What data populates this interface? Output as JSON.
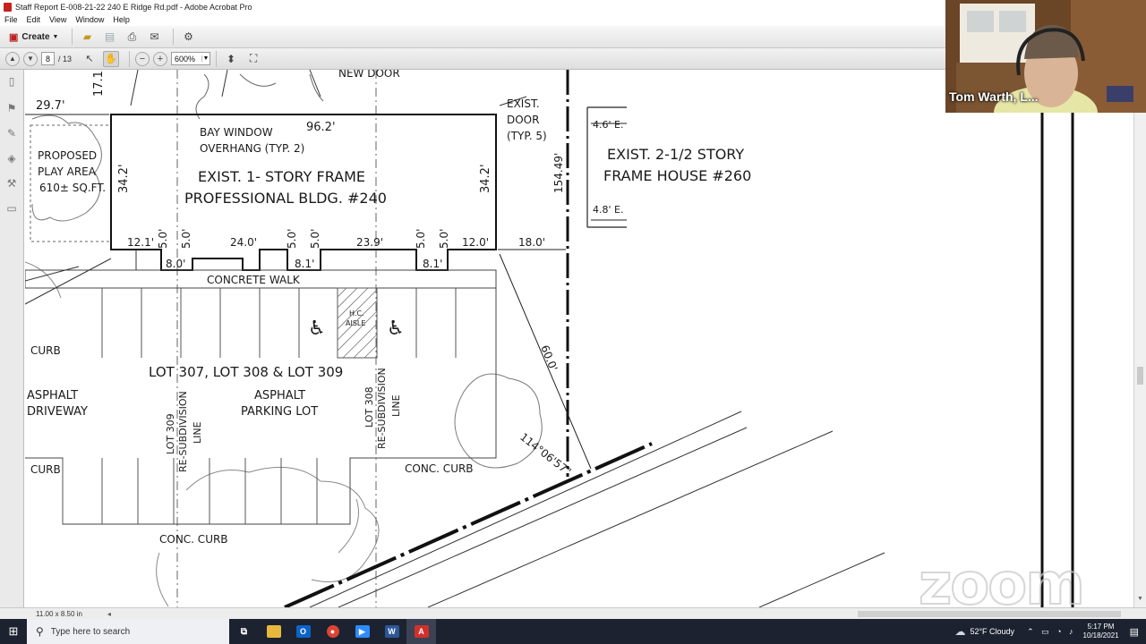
{
  "window": {
    "title": "Staff Report E-008-21-22 240 E Ridge Rd.pdf - Adobe Acrobat Pro"
  },
  "menu": [
    "File",
    "Edit",
    "View",
    "Window",
    "Help"
  ],
  "toolbar": {
    "create_label": "Create",
    "page_current": "8",
    "page_total": "/ 13",
    "zoom_value": "600%"
  },
  "document": {
    "page_size": "11.00 x 8.50 in",
    "labels": {
      "dim_29_7": "29.7'",
      "dim_17_1": "17.1'",
      "new_door": "NEW DOOR",
      "exist_door_1": "EXIST.",
      "exist_door_2": "DOOR",
      "exist_door_3": "(TYP. 5)",
      "bay_window_1": "BAY WINDOW",
      "bay_window_2": "OVERHANG (TYP. 2)",
      "dim_96_2": "96.2'",
      "proposed_1": "PROPOSED",
      "proposed_2": "PLAY AREA",
      "proposed_3": "610± SQ.FT.",
      "dim_34_2_left": "34.2'",
      "dim_34_2_right": "34.2'",
      "bldg_1": "EXIST. 1- STORY FRAME",
      "bldg_2": "PROFESSIONAL BLDG. #240",
      "dim_154_49": "154.49'",
      "dim_4_6": "4.6' E.",
      "dim_4_8": "4.8' E.",
      "house_1": "EXIST. 2-1/2 STORY",
      "house_2": "FRAME HOUSE #260",
      "dim_12_1": "12.1'",
      "dim_5_0_a": "5.0'",
      "dim_5_0_b": "5.0'",
      "dim_24_0": "24.0'",
      "dim_5_0_c": "5.0'",
      "dim_5_0_d": "5.0'",
      "dim_23_9": "23.9'",
      "dim_5_0_e": "5.0'",
      "dim_5_0_f": "5.0'",
      "dim_12_0": "12.0'",
      "dim_18_0": "18.0'",
      "dim_8_0": "8.0'",
      "dim_8_1_a": "8.1'",
      "dim_8_1_b": "8.1'",
      "concrete_walk": "CONCRETE WALK",
      "hc_aisle_1": "H.C.",
      "hc_aisle_2": "AISLE",
      "curb_top": "CURB",
      "lots": "LOT 307, LOT 308 & LOT 309",
      "asphalt_drive_1": "ASPHALT",
      "asphalt_drive_2": "DRIVEWAY",
      "asphalt_lot_1": "ASPHALT",
      "asphalt_lot_2": "PARKING LOT",
      "lot309_1": "LOT 309",
      "lot309_2": "RE-SUBDIVISION",
      "lot309_3": "LINE",
      "lot308_1": "LOT 308",
      "lot308_2": "RE-SUBDIVISION",
      "lot308_3": "LINE",
      "dim_60_0": "60.0'",
      "bearing": "114°06'57\"",
      "curb_mid": "CURB",
      "conc_curb_right": "CONC. CURB",
      "conc_curb_bottom": "CONC. CURB"
    }
  },
  "zoom": {
    "participant_name": "Tom Warth, L...",
    "watermark": "zoom"
  },
  "taskbar": {
    "search_placeholder": "Type here to search",
    "weather": "52°F  Cloudy",
    "time": "5:17 PM",
    "date": "10/18/2021"
  }
}
